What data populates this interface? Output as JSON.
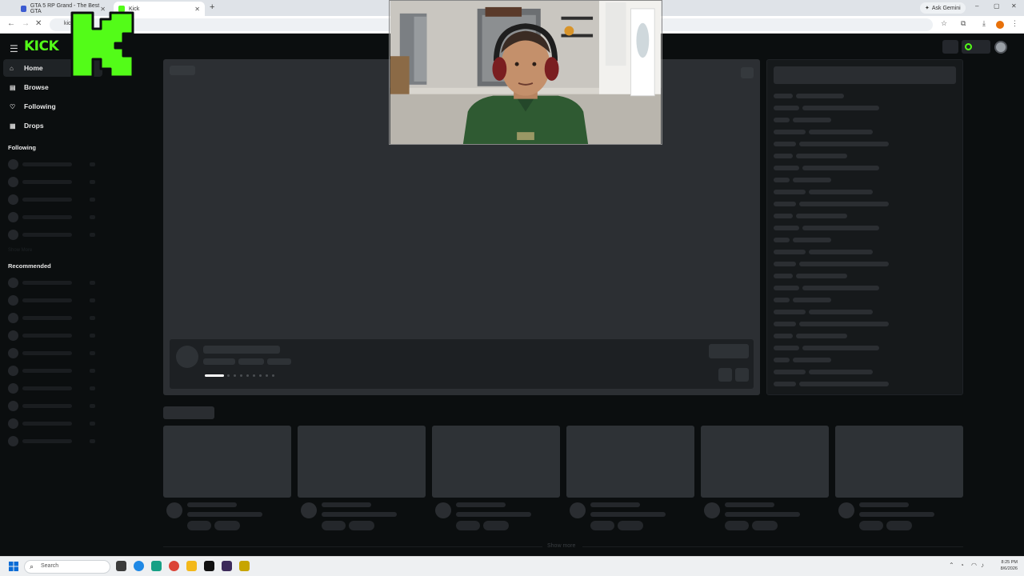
{
  "browser": {
    "tabs": [
      {
        "title": "GTA 5 RP Grand - The Best GTA",
        "active": false
      },
      {
        "title": "Kick",
        "active": true
      }
    ],
    "new_tab_glyph": "+",
    "ask_gemini": "Ask Gemini",
    "url": "kick.com",
    "window_controls": [
      "–",
      "▢",
      "✕"
    ]
  },
  "kick": {
    "logo": "KICK",
    "brand_color": "#53fc18",
    "nav": [
      {
        "label": "Home",
        "icon": "home-icon",
        "active": true
      },
      {
        "label": "Browse",
        "icon": "browse-icon",
        "active": false
      },
      {
        "label": "Following",
        "icon": "heart-icon",
        "active": false
      },
      {
        "label": "Drops",
        "icon": "drops-icon",
        "active": false
      }
    ],
    "sections": {
      "following": "Following",
      "recommended": "Recommended",
      "show_more_side": "Show More",
      "show_more_bottom": "Show more"
    }
  },
  "taskbar": {
    "search_placeholder": "Search",
    "clock_time": "8:25 PM",
    "clock_date": "8/6/2026"
  }
}
